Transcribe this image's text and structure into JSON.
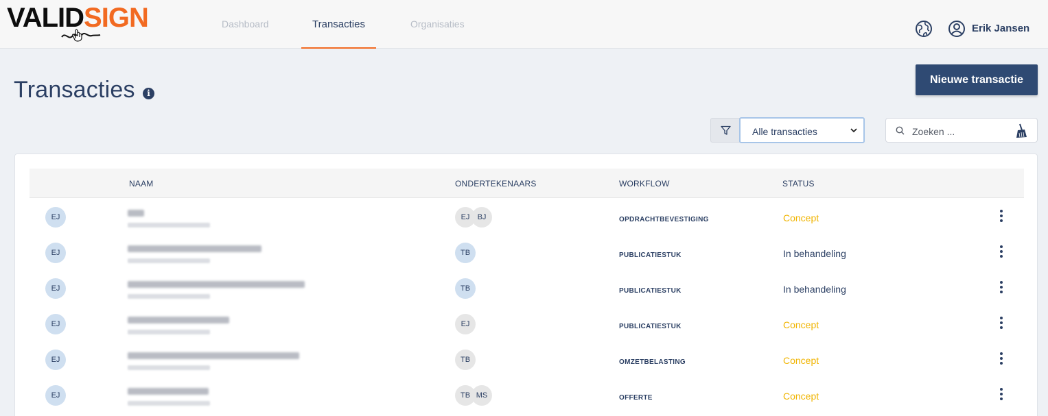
{
  "header": {
    "logo": {
      "part1": "VALID",
      "part2": "SIGN"
    },
    "nav": [
      {
        "label": "Dashboard",
        "active": false
      },
      {
        "label": "Transacties",
        "active": true
      },
      {
        "label": "Organisaties",
        "active": false
      }
    ],
    "globe_icon": "globe-icon",
    "user_icon": "user-circle-icon",
    "user_name": "Erik Jansen"
  },
  "page": {
    "title": "Transacties",
    "info_icon": "i",
    "new_button": "Nieuwe transactie"
  },
  "filters": {
    "filter_icon": "funnel-icon",
    "select_value": "Alle transacties",
    "search_placeholder": "Zoeken ...",
    "clear_icon": "broom-icon"
  },
  "table": {
    "columns": [
      "NAAM",
      "ONDERTEKENAARS",
      "WORKFLOW",
      "STATUS"
    ],
    "rows": [
      {
        "owner": "EJ",
        "signers": [
          "EJ",
          "BJ"
        ],
        "workflow": "OPDRACHTBEVESTIGING",
        "status": "Concept"
      },
      {
        "owner": "EJ",
        "signers": [
          "TB"
        ],
        "workflow": "PUBLICATIESTUK",
        "status": "In behandeling"
      },
      {
        "owner": "EJ",
        "signers": [
          "TB"
        ],
        "workflow": "PUBLICATIESTUK",
        "status": "In behandeling"
      },
      {
        "owner": "EJ",
        "signers": [
          "EJ"
        ],
        "workflow": "PUBLICATIESTUK",
        "status": "Concept"
      },
      {
        "owner": "EJ",
        "signers": [
          "TB"
        ],
        "workflow": "OMZETBELASTING",
        "status": "Concept"
      },
      {
        "owner": "EJ",
        "signers": [
          "TB",
          "MS"
        ],
        "workflow": "OFFERTE",
        "status": "Concept"
      }
    ]
  },
  "colors": {
    "accent": "#f26a21",
    "primary": "#2f4a73",
    "concept": "#f0b400"
  }
}
